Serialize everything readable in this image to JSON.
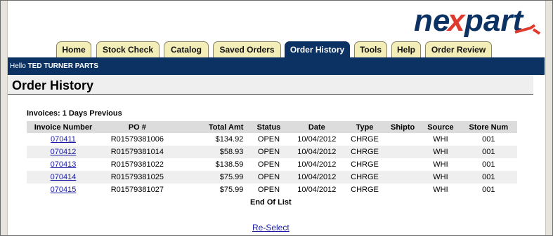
{
  "brand": {
    "logo_text": "nexpart"
  },
  "tabs": [
    {
      "label": "Home"
    },
    {
      "label": "Stock Check"
    },
    {
      "label": "Catalog"
    },
    {
      "label": "Saved Orders"
    },
    {
      "label": "Order History",
      "active": true
    },
    {
      "label": "Tools"
    },
    {
      "label": "Help"
    },
    {
      "label": "Order Review"
    }
  ],
  "greeting": {
    "prefix": "Hello ",
    "name": "TED TURNER PARTS"
  },
  "page_title": "Order History",
  "invoices_caption": "Invoices: 1 Days Previous",
  "table": {
    "headers": [
      "Invoice Number",
      "PO #",
      "Total Amt",
      "Status",
      "Date",
      "Type",
      "Shipto",
      "Source",
      "Store Num"
    ],
    "rows": [
      {
        "invoice": "070411",
        "po": "R01579381006",
        "amt": "$134.92",
        "status": "OPEN",
        "date": "10/04/2012",
        "type": "CHRGE",
        "shipto": "",
        "source": "WHI",
        "store": "001"
      },
      {
        "invoice": "070412",
        "po": "R01579381014",
        "amt": "$58.93",
        "status": "OPEN",
        "date": "10/04/2012",
        "type": "CHRGE",
        "shipto": "",
        "source": "WHI",
        "store": "001"
      },
      {
        "invoice": "070413",
        "po": "R01579381022",
        "amt": "$138.59",
        "status": "OPEN",
        "date": "10/04/2012",
        "type": "CHRGE",
        "shipto": "",
        "source": "WHI",
        "store": "001"
      },
      {
        "invoice": "070414",
        "po": "R01579381025",
        "amt": "$75.99",
        "status": "OPEN",
        "date": "10/04/2012",
        "type": "CHRGE",
        "shipto": "",
        "source": "WHI",
        "store": "001"
      },
      {
        "invoice": "070415",
        "po": "R01579381027",
        "amt": "$75.99",
        "status": "OPEN",
        "date": "10/04/2012",
        "type": "CHRGE",
        "shipto": "",
        "source": "WHI",
        "store": "001"
      }
    ]
  },
  "end_of_list": "End Of List",
  "reselect_label": "Re-Select",
  "colors": {
    "nav_blue": "#0c3264",
    "tab_bg": "#f3edb8",
    "logo_red": "#e03a2e",
    "link": "#1a1aa6"
  }
}
